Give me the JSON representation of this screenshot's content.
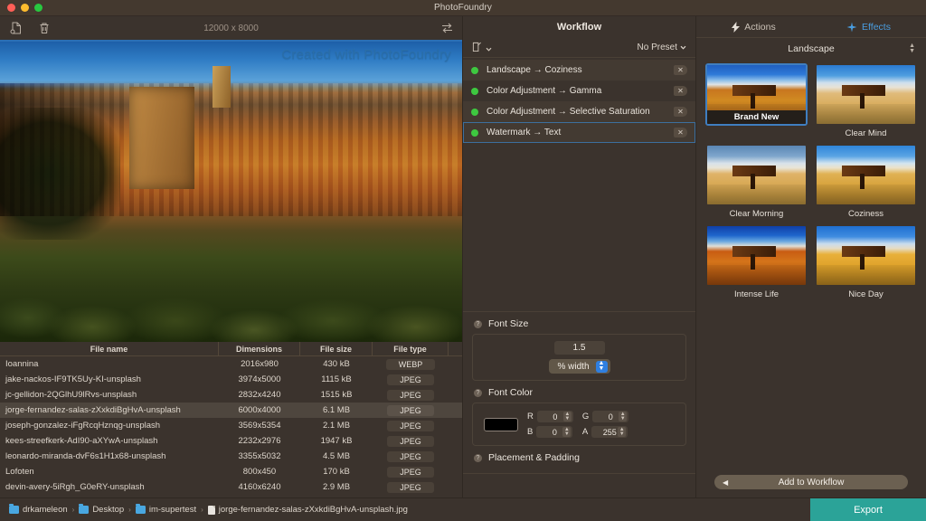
{
  "window": {
    "title": "PhotoFoundry"
  },
  "left_toolbar": {
    "open_icon": "document-add-icon",
    "delete_icon": "trash-icon",
    "dimensions": "12000 x 8000",
    "compare_icon": "swap-arrows-icon"
  },
  "canvas": {
    "watermark_text": "Created with PhotoFoundry"
  },
  "file_table": {
    "columns": [
      "File name",
      "Dimensions",
      "File size",
      "File type"
    ],
    "rows": [
      {
        "name": "Ioannina",
        "dimensions": "2016x980",
        "size": "430 kB",
        "type": "WEBP",
        "selected": false
      },
      {
        "name": "jake-nackos-IF9TK5Uy-KI-unsplash",
        "dimensions": "3974x5000",
        "size": "1115 kB",
        "type": "JPEG",
        "selected": false
      },
      {
        "name": "jc-gellidon-2QGlhU9lRvs-unsplash",
        "dimensions": "2832x4240",
        "size": "1515 kB",
        "type": "JPEG",
        "selected": false
      },
      {
        "name": "jorge-fernandez-salas-zXxkdiBgHvA-unsplash",
        "dimensions": "6000x4000",
        "size": "6.1 MB",
        "type": "JPEG",
        "selected": true
      },
      {
        "name": "joseph-gonzalez-iFgRcqHznqg-unsplash",
        "dimensions": "3569x5354",
        "size": "2.1 MB",
        "type": "JPEG",
        "selected": false
      },
      {
        "name": "kees-streefkerk-AdI90-aXYwA-unsplash",
        "dimensions": "2232x2976",
        "size": "1947 kB",
        "type": "JPEG",
        "selected": false
      },
      {
        "name": "leonardo-miranda-dvF6s1H1x68-unsplash",
        "dimensions": "3355x5032",
        "size": "4.5 MB",
        "type": "JPEG",
        "selected": false
      },
      {
        "name": "Lofoten",
        "dimensions": "800x450",
        "size": "170 kB",
        "type": "JPEG",
        "selected": false
      },
      {
        "name": "devin-avery-5iRgh_G0eRY-unsplash",
        "dimensions": "4160x6240",
        "size": "2.9 MB",
        "type": "JPEG",
        "selected": false
      }
    ]
  },
  "workflow": {
    "title": "Workflow",
    "new_icon": "edit-square-icon",
    "new_chevron_icon": "chevron-down-icon",
    "preset_label": "No Preset",
    "preset_chevron_icon": "chevron-down-icon",
    "items": [
      {
        "label": "Landscape → Coziness",
        "enabled": true,
        "selected": false,
        "delete_icon": "delete-tag-icon"
      },
      {
        "label": "Color Adjustment → Gamma",
        "enabled": true,
        "selected": false,
        "delete_icon": "delete-tag-icon"
      },
      {
        "label": "Color Adjustment → Selective Saturation",
        "enabled": true,
        "selected": false,
        "delete_icon": "delete-tag-icon"
      },
      {
        "label": "Watermark → Text",
        "enabled": true,
        "selected": true,
        "delete_icon": "delete-tag-icon"
      }
    ]
  },
  "inspector": {
    "font_size": {
      "help_icon": "help-icon",
      "heading": "Font Size",
      "value": "1.5",
      "unit": "% width",
      "unit_stepper_icon": "stepper-icon"
    },
    "font_color": {
      "help_icon": "help-icon",
      "heading": "Font Color",
      "swatch_hex": "#000000",
      "channels": [
        {
          "label": "R",
          "value": "0"
        },
        {
          "label": "G",
          "value": "0"
        },
        {
          "label": "B",
          "value": "0"
        },
        {
          "label": "A",
          "value": "255"
        }
      ]
    },
    "placement": {
      "help_icon": "help-icon",
      "heading": "Placement & Padding"
    }
  },
  "right_panel": {
    "tabs": [
      {
        "label": "Actions",
        "icon": "lightning-bolt-icon",
        "active": false
      },
      {
        "label": "Effects",
        "icon": "sparkle-icon",
        "active": true
      }
    ],
    "category": "Landscape",
    "category_stepper_icon": "stepper-icon",
    "effects": [
      {
        "label": "Brand New",
        "selected": true
      },
      {
        "label": "Clear Mind",
        "selected": false
      },
      {
        "label": "Clear Morning",
        "selected": false
      },
      {
        "label": "Coziness",
        "selected": false
      },
      {
        "label": "Intense Life",
        "selected": false
      },
      {
        "label": "Nice Day",
        "selected": false
      }
    ],
    "add_button": {
      "label": "Add to Workflow",
      "arrow_icon": "arrow-left-icon"
    }
  },
  "status_bar": {
    "breadcrumbs": [
      {
        "label": "drkameleon",
        "icon": "folder-icon"
      },
      {
        "label": "Desktop",
        "icon": "folder-icon"
      },
      {
        "label": "im-supertest",
        "icon": "folder-icon"
      },
      {
        "label": "jorge-fernandez-salas-zXxkdiBgHvA-unsplash.jpg",
        "icon": "file-icon"
      }
    ],
    "separator": "›",
    "export_label": "Export"
  },
  "colors": {
    "accent_blue": "#3f7ec0",
    "export_teal": "#2ba398",
    "enabled_green": "#3ec840",
    "chrome_brown": "#3b332d"
  }
}
